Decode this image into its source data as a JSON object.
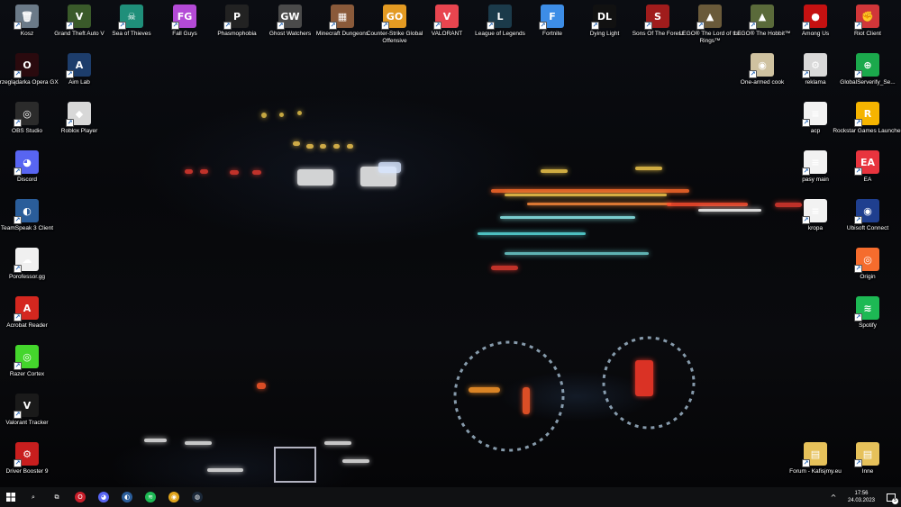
{
  "desktop": {
    "icons": [
      {
        "id": "kosz",
        "label": "Kosz",
        "glyph": "🗑",
        "color": "#6b7a88",
        "icon": "recycle-bin-icon"
      },
      {
        "id": "gta",
        "label": "Grand Theft Auto V",
        "glyph": "V",
        "color": "#3a5a2a",
        "icon": "gta-v-icon"
      },
      {
        "id": "sot",
        "label": "Sea of Thieves",
        "glyph": "☠",
        "color": "#1f8f7a",
        "icon": "sea-of-thieves-icon"
      },
      {
        "id": "fallguys",
        "label": "Fall Guys",
        "glyph": "FG",
        "color": "#b44ad6",
        "icon": "fall-guys-icon"
      },
      {
        "id": "phasmo",
        "label": "Phasmophobia",
        "glyph": "P",
        "color": "#222",
        "icon": "phasmophobia-icon"
      },
      {
        "id": "ghost",
        "label": "Ghost Watchers",
        "glyph": "GW",
        "color": "#4a4a4a",
        "icon": "ghost-watchers-icon"
      },
      {
        "id": "mcd",
        "label": "Minecraft Dungeons",
        "glyph": "▦",
        "color": "#8a5a3a",
        "icon": "minecraft-dungeons-icon"
      },
      {
        "id": "csgo",
        "label": "Counter-Strike Global Offensive",
        "glyph": "GO",
        "color": "#e39a22",
        "icon": "csgo-icon"
      },
      {
        "id": "valorant",
        "label": "VALORANT",
        "glyph": "V",
        "color": "#e8454f",
        "icon": "valorant-icon"
      },
      {
        "id": "lol",
        "label": "League of Legends",
        "glyph": "L",
        "color": "#1b3a4a",
        "icon": "league-of-legends-icon"
      },
      {
        "id": "fortnite",
        "label": "Fortnite",
        "glyph": "F",
        "color": "#3d8de6",
        "icon": "fortnite-icon"
      },
      {
        "id": "dying",
        "label": "Dying Light",
        "glyph": "DL",
        "color": "#111",
        "icon": "dying-light-icon"
      },
      {
        "id": "sotf",
        "label": "Sons Of The Forest",
        "glyph": "S",
        "color": "#a01c1c",
        "icon": "sons-of-the-forest-icon"
      },
      {
        "id": "lotr",
        "label": "LEGO® The Lord of the Rings™",
        "glyph": "▲",
        "color": "#6a5a3a",
        "icon": "lego-lotr-icon"
      },
      {
        "id": "hobbit",
        "label": "LEGO® The Hobbit™",
        "glyph": "▲",
        "color": "#5a6a3a",
        "icon": "lego-hobbit-icon"
      },
      {
        "id": "amongus",
        "label": "Among Us",
        "glyph": "●",
        "color": "#c51111",
        "icon": "among-us-icon"
      },
      {
        "id": "riot",
        "label": "Riot Client",
        "glyph": "✊",
        "color": "#d13639",
        "icon": "riot-client-icon"
      },
      {
        "id": "opera",
        "label": "Przeglądarka Opera GX",
        "glyph": "O",
        "color": "#2a0a0e",
        "icon": "opera-gx-icon"
      },
      {
        "id": "aimlab",
        "label": "Aim Lab",
        "glyph": "A",
        "color": "#1d3d6b",
        "icon": "aim-lab-icon"
      },
      {
        "id": "onearmed",
        "label": "One-armed cook",
        "glyph": "◉",
        "color": "#cfc2a0",
        "icon": "one-armed-cook-icon"
      },
      {
        "id": "reklama",
        "label": "reklama",
        "glyph": "⚙",
        "color": "#d9d9d9",
        "icon": "reklama-file-icon"
      },
      {
        "id": "gss",
        "label": "GlobalServerify_Se...",
        "glyph": "⊕",
        "color": "#1ba94c",
        "icon": "globalserverify-icon"
      },
      {
        "id": "obs",
        "label": "OBS Studio",
        "glyph": "◎",
        "color": "#2b2b2b",
        "icon": "obs-studio-icon"
      },
      {
        "id": "roblox",
        "label": "Roblox Player",
        "glyph": "◆",
        "color": "#d8d8d8",
        "icon": "roblox-icon"
      },
      {
        "id": "acp",
        "label": "acp",
        "glyph": "≡",
        "color": "#f2f2f2",
        "icon": "acp-file-icon"
      },
      {
        "id": "rockstar",
        "label": "Rockstar Games Launcher",
        "glyph": "R",
        "color": "#f5b400",
        "icon": "rockstar-launcher-icon"
      },
      {
        "id": "discord",
        "label": "Discord",
        "glyph": "◕",
        "color": "#5865f2",
        "icon": "discord-icon"
      },
      {
        "id": "pasy",
        "label": "pasy main",
        "glyph": "≡",
        "color": "#f2f2f2",
        "icon": "pasy-main-file-icon"
      },
      {
        "id": "ea",
        "label": "EA",
        "glyph": "EA",
        "color": "#e8343e",
        "icon": "ea-icon"
      },
      {
        "id": "ts3",
        "label": "TeamSpeak 3 Client",
        "glyph": "◐",
        "color": "#2a5d9a",
        "icon": "teamspeak-icon"
      },
      {
        "id": "kropa",
        "label": "kropa",
        "glyph": "≡",
        "color": "#f2f2f2",
        "icon": "kropa-file-icon"
      },
      {
        "id": "ubisoft",
        "label": "Ubisoft Connect",
        "glyph": "◉",
        "color": "#1f3f8f",
        "icon": "ubisoft-connect-icon"
      },
      {
        "id": "porofessor",
        "label": "Porofessor.gg",
        "glyph": "☁",
        "color": "#f0f0f0",
        "icon": "porofessor-icon"
      },
      {
        "id": "origin",
        "label": "Origin",
        "glyph": "◎",
        "color": "#f56c2d",
        "icon": "origin-icon"
      },
      {
        "id": "acrobat",
        "label": "Acrobat Reader",
        "glyph": "A",
        "color": "#d4271f",
        "icon": "acrobat-reader-icon"
      },
      {
        "id": "spotify",
        "label": "Spotify",
        "glyph": "≋",
        "color": "#1db954",
        "icon": "spotify-icon"
      },
      {
        "id": "razer",
        "label": "Razer Cortex",
        "glyph": "◎",
        "color": "#44d62c",
        "icon": "razer-cortex-icon"
      },
      {
        "id": "valtracker",
        "label": "Valorant Tracker",
        "glyph": "V",
        "color": "#1a1a1a",
        "icon": "valorant-tracker-icon"
      },
      {
        "id": "driverbooster",
        "label": "Driver Booster 9",
        "glyph": "⚙",
        "color": "#c81e1e",
        "icon": "driver-booster-icon"
      },
      {
        "id": "forum",
        "label": "Forum - Kafisjmy.eu",
        "glyph": "▤",
        "color": "#e6c15a",
        "icon": "forum-folder-icon"
      },
      {
        "id": "inne",
        "label": "Inne",
        "glyph": "▤",
        "color": "#e6c15a",
        "icon": "inne-folder-icon"
      }
    ]
  },
  "taskbar": {
    "start_icon": "windows-start-icon",
    "pinned": [
      {
        "id": "search",
        "glyph": "⌕",
        "color": "transparent",
        "icon": "search-icon"
      },
      {
        "id": "taskview",
        "glyph": "⧉",
        "color": "transparent",
        "icon": "task-view-icon"
      },
      {
        "id": "opera",
        "glyph": "O",
        "color": "#c81e2a",
        "icon": "opera-gx-icon"
      },
      {
        "id": "discord",
        "glyph": "◕",
        "color": "#5865f2",
        "icon": "discord-icon"
      },
      {
        "id": "ts",
        "glyph": "◐",
        "color": "#2a5d9a",
        "icon": "teamspeak-icon"
      },
      {
        "id": "spotify",
        "glyph": "≋",
        "color": "#1db954",
        "icon": "spotify-icon"
      },
      {
        "id": "chrome",
        "glyph": "◉",
        "color": "#e0a41c",
        "icon": "chrome-icon"
      },
      {
        "id": "steam",
        "glyph": "◍",
        "color": "#1b2838",
        "icon": "steam-icon"
      }
    ],
    "tray": {
      "chevron": "^",
      "time": "17:56",
      "date": "24.03.2023",
      "notification_count": "5"
    }
  }
}
